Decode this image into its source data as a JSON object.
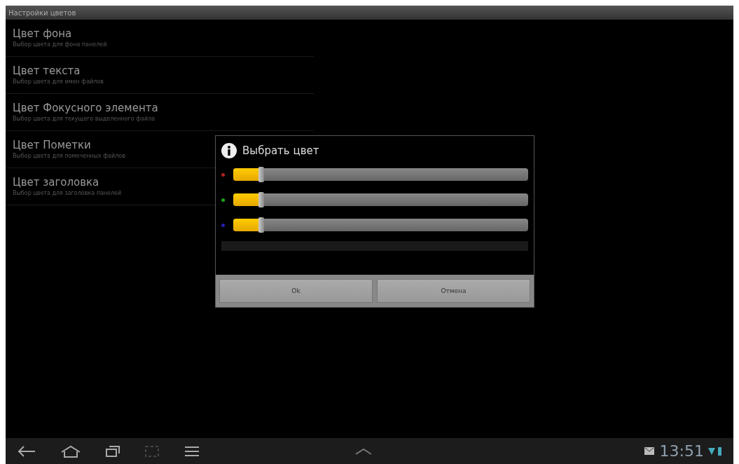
{
  "window": {
    "title": "Настройки цветов"
  },
  "settings": [
    {
      "title": "Цвет фона",
      "summary": "Выбор цвета для фона панелей"
    },
    {
      "title": "Цвет текста",
      "summary": "Выбор цвета для имен файлов"
    },
    {
      "title": "Цвет Фокусного элемента",
      "summary": "Выбор цвета для текущего выделенного файла"
    },
    {
      "title": "Цвет Пометки",
      "summary": "Выбор цвета для помеченных файлов"
    },
    {
      "title": "Цвет заголовка",
      "summary": "Выбор цвета для заголовка панелей"
    }
  ],
  "dialog": {
    "title": "Выбрать цвет",
    "channels": [
      {
        "color": "#b02020",
        "level": 0.09
      },
      {
        "color": "#20a020",
        "level": 0.09
      },
      {
        "color": "#2020b0",
        "level": 0.09
      }
    ],
    "buttons": [
      "Ok",
      "Отмена"
    ]
  },
  "status_bar": {
    "time": "13:51"
  }
}
